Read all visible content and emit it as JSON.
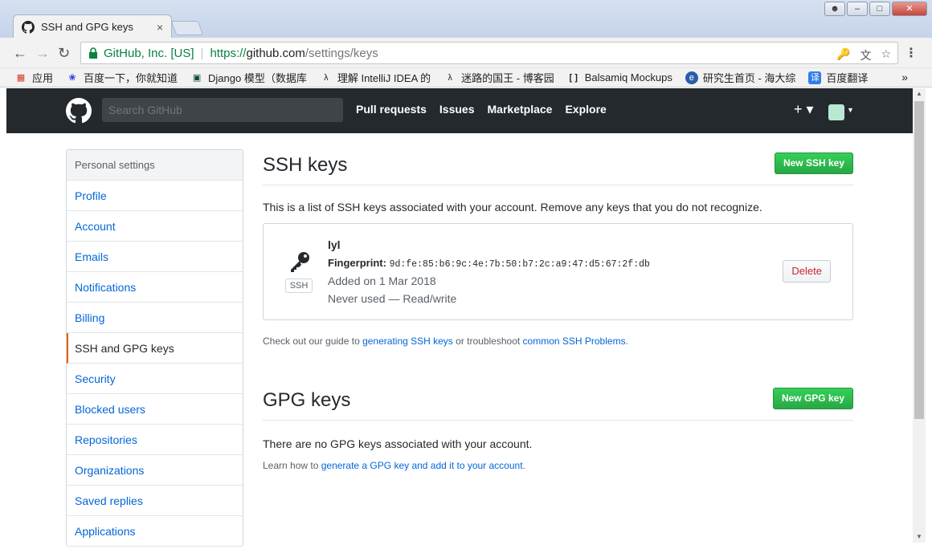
{
  "browser": {
    "tab_title": "SSH and GPG keys",
    "tab_close": "×",
    "org_label": "GitHub, Inc. [US]",
    "url_scheme": "https://",
    "url_host": "github.com",
    "url_path": "/settings/keys",
    "bookmarks": [
      {
        "label": "应用",
        "icon": "apps-grid-icon"
      },
      {
        "label": "百度一下，你就知道",
        "icon": "baidu-paw-icon"
      },
      {
        "label": "Django 模型（数据库",
        "icon": "django-icon"
      },
      {
        "label": "理解 IntelliJ IDEA 的",
        "icon": "csdn-icon"
      },
      {
        "label": "迷路的国王 - 博客园",
        "icon": "csdn-icon"
      },
      {
        "label": "Balsamiq Mockups",
        "icon": "balsamiq-icon"
      },
      {
        "label": "研究生首页 - 海大综",
        "icon": "school-icon"
      },
      {
        "label": "百度翻译",
        "icon": "translate-icon"
      }
    ],
    "bookmarks_more": "»"
  },
  "header": {
    "search_placeholder": "Search GitHub",
    "nav": [
      "Pull requests",
      "Issues",
      "Marketplace",
      "Explore"
    ],
    "plus_label": "+ ▾"
  },
  "sidebar": {
    "heading": "Personal settings",
    "items": [
      {
        "label": "Profile",
        "active": false
      },
      {
        "label": "Account",
        "active": false
      },
      {
        "label": "Emails",
        "active": false
      },
      {
        "label": "Notifications",
        "active": false
      },
      {
        "label": "Billing",
        "active": false
      },
      {
        "label": "SSH and GPG keys",
        "active": true
      },
      {
        "label": "Security",
        "active": false
      },
      {
        "label": "Blocked users",
        "active": false
      },
      {
        "label": "Repositories",
        "active": false
      },
      {
        "label": "Organizations",
        "active": false
      },
      {
        "label": "Saved replies",
        "active": false
      },
      {
        "label": "Applications",
        "active": false
      }
    ]
  },
  "ssh": {
    "title": "SSH keys",
    "new_button": "New SSH key",
    "description": "This is a list of SSH keys associated with your account. Remove any keys that you do not recognize.",
    "key": {
      "name": "lyl",
      "fingerprint_label": "Fingerprint:",
      "fingerprint": "9d:fe:85:b6:9c:4e:7b:50:b7:2c:a9:47:d5:67:2f:db",
      "added": "Added on 1 Mar 2018",
      "usage": "Never used — Read/write",
      "badge": "SSH",
      "delete_button": "Delete"
    },
    "guide_prefix": "Check out our guide to ",
    "guide_link1": "generating SSH keys",
    "guide_middle": " or troubleshoot ",
    "guide_link2": "common SSH Problems",
    "guide_suffix": "."
  },
  "gpg": {
    "title": "GPG keys",
    "new_button": "New GPG key",
    "empty_text": "There are no GPG keys associated with your account.",
    "learn_prefix": "Learn how to ",
    "learn_link": "generate a GPG key and add it to your account",
    "learn_suffix": "."
  },
  "colors": {
    "header_bg": "#24292e",
    "link": "#0366d6",
    "green": "#28a745",
    "danger": "#cb2431",
    "active_border": "#e36209"
  }
}
